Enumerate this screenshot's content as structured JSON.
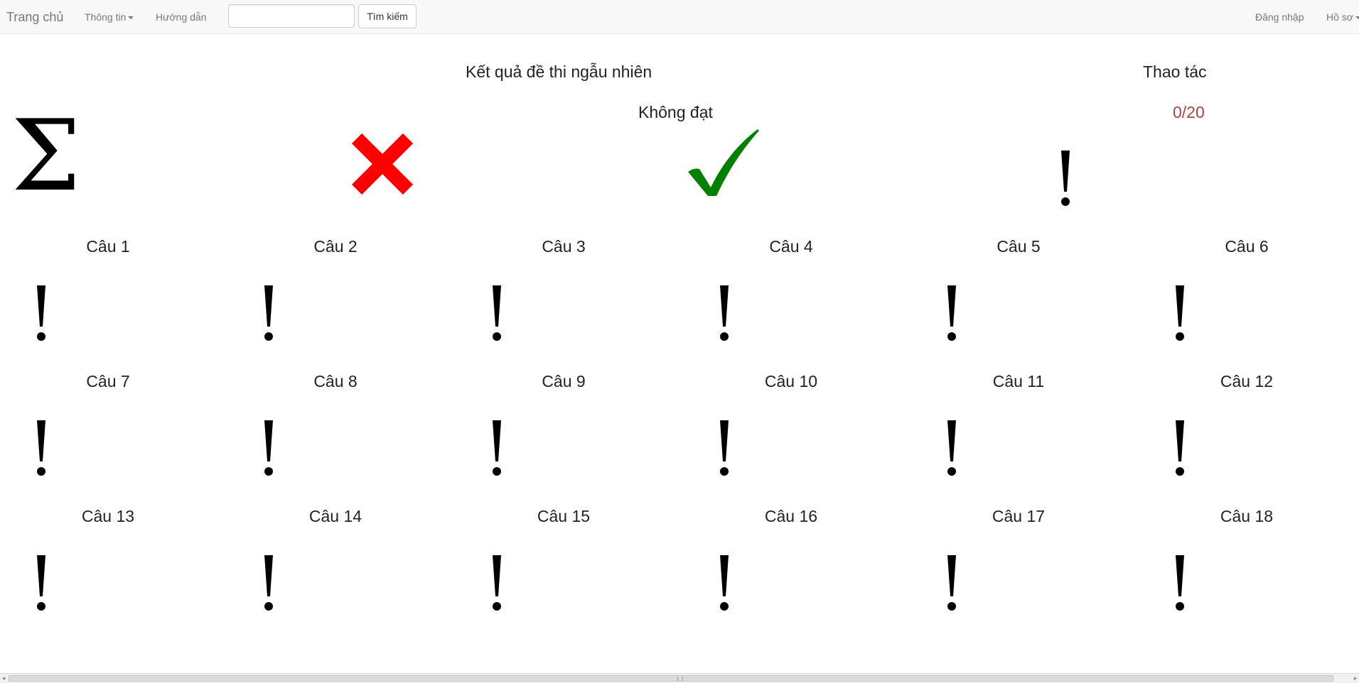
{
  "navbar": {
    "brand": "Trang chủ",
    "info_menu": "Thông tin",
    "guide": "Hướng dẫn",
    "search_placeholder": "",
    "search_button": "Tìm kiếm",
    "login": "Đăng nhập",
    "profile_menu": "Hồ sơ"
  },
  "summary": {
    "title": "Kết quả đề thi ngẫu nhiên",
    "actions_title": "Thao tác",
    "status": "Không đạt",
    "score": "0/20",
    "icons": [
      "sigma-icon",
      "cross-icon",
      "check-icon",
      "exclamation-icon"
    ],
    "colors": {
      "cross": "#ff0000",
      "check": "#008000",
      "score": "#a94442"
    }
  },
  "questions": [
    {
      "label": "Câu 1",
      "icon": "exclamation-icon"
    },
    {
      "label": "Câu 2",
      "icon": "exclamation-icon"
    },
    {
      "label": "Câu 3",
      "icon": "exclamation-icon"
    },
    {
      "label": "Câu 4",
      "icon": "exclamation-icon"
    },
    {
      "label": "Câu 5",
      "icon": "exclamation-icon"
    },
    {
      "label": "Câu 6",
      "icon": "exclamation-icon"
    },
    {
      "label": "Câu 7",
      "icon": "exclamation-icon"
    },
    {
      "label": "Câu 8",
      "icon": "exclamation-icon"
    },
    {
      "label": "Câu 9",
      "icon": "exclamation-icon"
    },
    {
      "label": "Câu 10",
      "icon": "exclamation-icon"
    },
    {
      "label": "Câu 11",
      "icon": "exclamation-icon"
    },
    {
      "label": "Câu 12",
      "icon": "exclamation-icon"
    },
    {
      "label": "Câu 13",
      "icon": "exclamation-icon"
    },
    {
      "label": "Câu 14",
      "icon": "exclamation-icon"
    },
    {
      "label": "Câu 15",
      "icon": "exclamation-icon"
    },
    {
      "label": "Câu 16",
      "icon": "exclamation-icon"
    },
    {
      "label": "Câu 17",
      "icon": "exclamation-icon"
    },
    {
      "label": "Câu 18",
      "icon": "exclamation-icon"
    }
  ]
}
